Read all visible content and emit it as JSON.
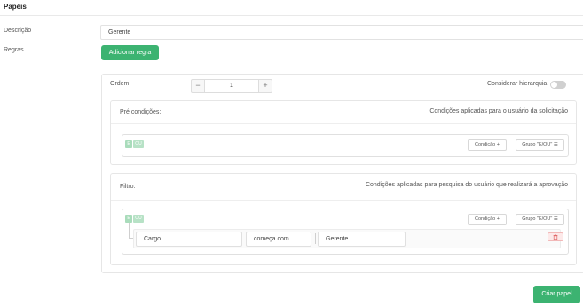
{
  "page": {
    "title": "Papéis"
  },
  "form": {
    "descricao_label": "Descrição",
    "descricao_value": "Gerente",
    "regras_label": "Regras",
    "add_rule_label": "Adicionar regra"
  },
  "rule": {
    "ordem_label": "Ordem",
    "ordem_value": "1",
    "minus": "−",
    "plus": "+",
    "hierarchy_label": "Considerar hierarquia",
    "hierarchy_enabled": false,
    "pre": {
      "title": "Pré condições:",
      "description": "Condições aplicadas para o usuário da solicitação",
      "op_and": "E",
      "op_or": "OU",
      "condition_button": "Condição +",
      "group_button": "Grupo \"E/OU\" ☰"
    },
    "filter": {
      "title": "Filtro:",
      "description": "Condições aplicadas para pesquisa do usuário que realizará a aprovação",
      "op_and": "E",
      "op_or": "OU",
      "condition_button": "Condição +",
      "group_button": "Grupo \"E/OU\" ☰",
      "condition": {
        "field": "Cargo",
        "operator": "começa com",
        "value": "Gerente"
      }
    }
  },
  "footer": {
    "create_label": "Criar papel"
  },
  "colors": {
    "accent": "#3cb371",
    "danger": "#e06a6a"
  },
  "icons": {
    "delete": "trash-icon"
  }
}
